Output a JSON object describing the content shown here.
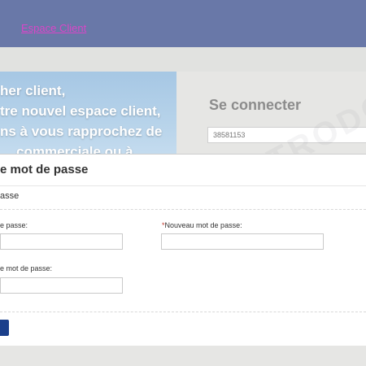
{
  "header": {
    "link_label": "Espace Client"
  },
  "hero": {
    "lines": [
      "her client,",
      "tre nouvel espace client,",
      "ns à vous rapprochez de",
      "commerciale ou à"
    ]
  },
  "login": {
    "title": "Se connecter",
    "username_value": "38581153"
  },
  "modal": {
    "title": "e mot de passe",
    "section_label": "asse",
    "fields": {
      "old_password_label": "e passe:",
      "new_password_label": "Nouveau mot de passe:",
      "confirm_password_label": "e mot de passe:",
      "required_marker": "*"
    }
  },
  "watermark": "ELECTRODOM",
  "colors": {
    "topbar": "#6978a8",
    "link": "#d946c8",
    "submit_button": "#1b3f8b",
    "required": "#c0392b"
  }
}
